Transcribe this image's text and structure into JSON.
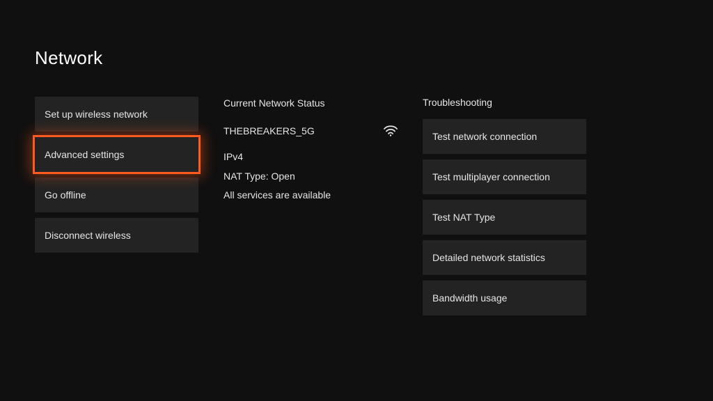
{
  "title": "Network",
  "left_menu": {
    "items": [
      {
        "label": "Set up wireless network",
        "selected": false
      },
      {
        "label": "Advanced settings",
        "selected": true
      },
      {
        "label": "Go offline",
        "selected": false
      },
      {
        "label": "Disconnect wireless",
        "selected": false
      }
    ]
  },
  "status": {
    "heading": "Current Network Status",
    "network_name": "THEBREAKERS_5G",
    "icon": "wifi-icon",
    "lines": [
      "IPv4",
      "NAT Type: Open",
      "All services are available"
    ]
  },
  "troubleshooting": {
    "heading": "Troubleshooting",
    "items": [
      {
        "label": "Test network connection"
      },
      {
        "label": "Test multiplayer connection"
      },
      {
        "label": "Test NAT Type"
      },
      {
        "label": "Detailed network statistics"
      },
      {
        "label": "Bandwidth usage"
      }
    ]
  },
  "colors": {
    "highlight": "#ff5a1f",
    "button_bg": "#232323",
    "page_bg": "#101010"
  }
}
